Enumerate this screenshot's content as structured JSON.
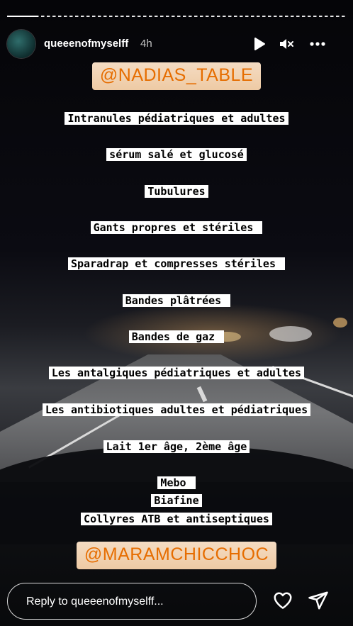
{
  "header": {
    "username": "queeenofmyselff",
    "time_ago": "4h",
    "icons": [
      "play-icon",
      "muted-speaker-icon",
      "more-icon"
    ]
  },
  "story": {
    "top_mention": "@NADIAS_TABLE",
    "lines": [
      "Intranules pédiatriques et adultes",
      "sérum salé et glucosé",
      "Tubulures",
      "Gants propres et stériles ",
      "Sparadrap et compresses stériles ",
      "Bandes plâtrées ",
      "Bandes de gaz ",
      "Les antalgiques pédiatriques et adultes",
      "Les antibiotiques adultes et pédiatriques",
      "Lait 1er âge, 2ème âge",
      "Mebo ",
      "Biafine",
      "Collyres ATB et antiseptiques"
    ],
    "bottom_mention": "@MARAMCHICCHOC"
  },
  "footer": {
    "reply_placeholder": "Reply to queeenofmyselff...",
    "icons": [
      "heart-icon",
      "send-icon"
    ]
  },
  "colors": {
    "text_background": "#ffffff",
    "mention_text": "#e66d00",
    "mention_background": "#f0d0b0"
  }
}
